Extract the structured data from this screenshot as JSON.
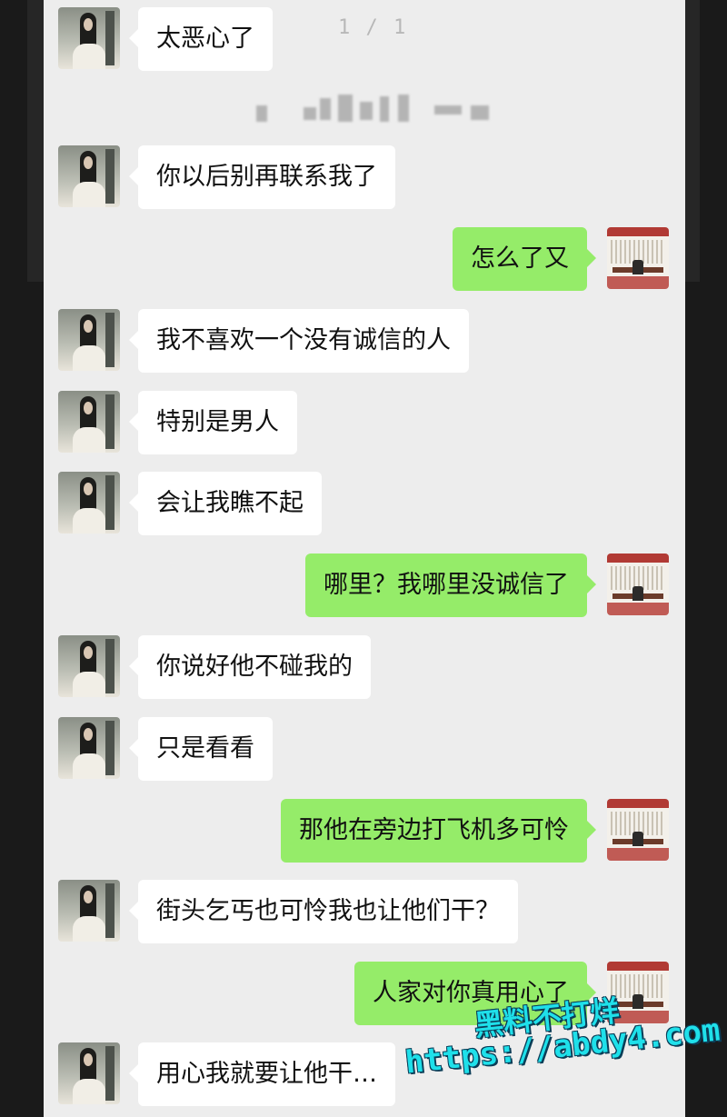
{
  "viewer": {
    "page_indicator": "1 / 1"
  },
  "messages": [
    {
      "from": "her",
      "text": "太恶心了"
    },
    {
      "from": "her",
      "text": "你以后别再联系我了"
    },
    {
      "from": "me",
      "text": "怎么了又"
    },
    {
      "from": "her",
      "text": "我不喜欢一个没有诚信的人"
    },
    {
      "from": "her",
      "text": "特别是男人"
    },
    {
      "from": "her",
      "text": "会让我瞧不起"
    },
    {
      "from": "me",
      "text": "哪里？我哪里没诚信了"
    },
    {
      "from": "her",
      "text": "你说好他不碰我的"
    },
    {
      "from": "her",
      "text": "只是看看"
    },
    {
      "from": "me",
      "text": "那他在旁边打飞机多可怜"
    },
    {
      "from": "her",
      "text": "街头乞丐也可怜我也让他们干？"
    },
    {
      "from": "me",
      "text": "人家对你真用心了"
    },
    {
      "from": "her",
      "text": "用心我就要让他干…"
    }
  ],
  "watermark": {
    "name": "黑料不打烊",
    "url": "https://abdy4.com"
  },
  "colors": {
    "incoming_bubble": "#ffffff",
    "outgoing_bubble": "#95ec69",
    "background": "#ededed",
    "watermark": "#1fe0ea"
  }
}
